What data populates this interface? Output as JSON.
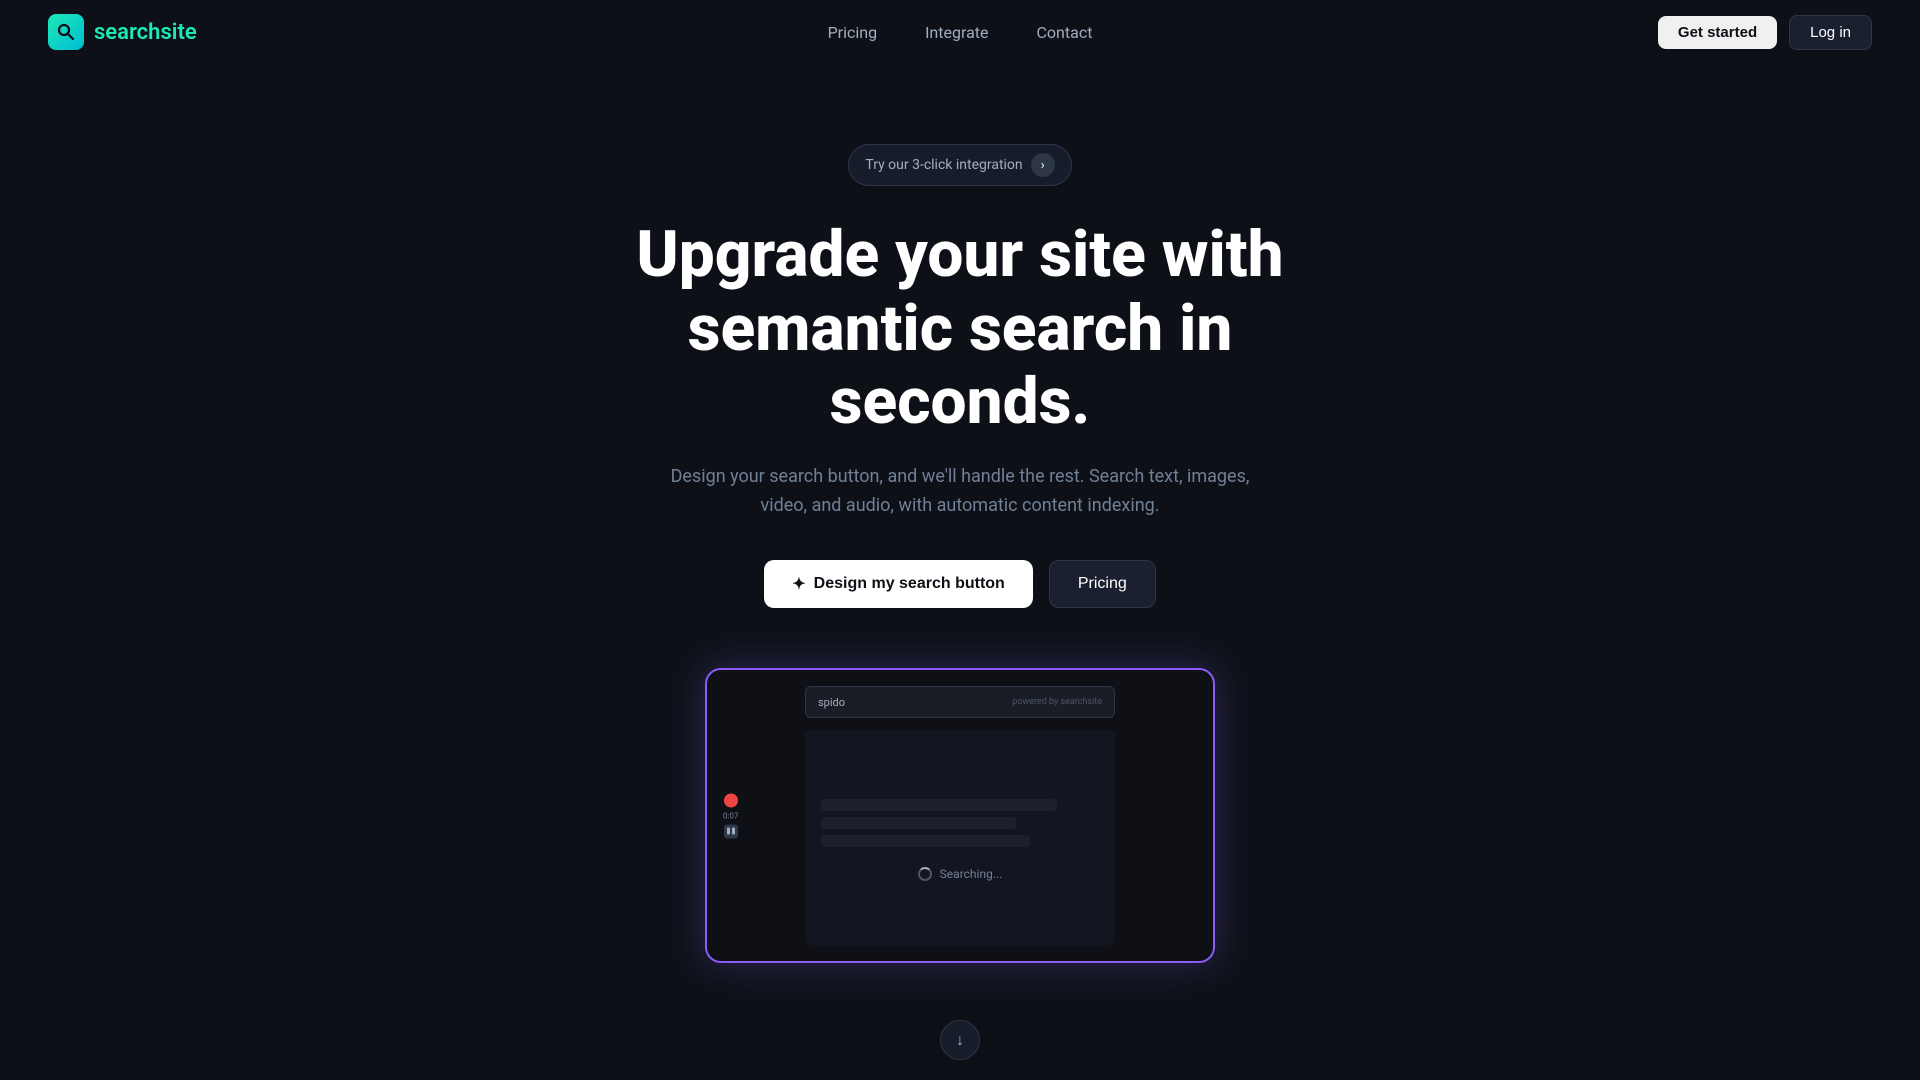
{
  "navbar": {
    "logo_icon": "Q",
    "logo_search": "search",
    "logo_site": "site",
    "nav_links": [
      {
        "id": "pricing",
        "label": "Pricing"
      },
      {
        "id": "integrate",
        "label": "Integrate"
      },
      {
        "id": "contact",
        "label": "Contact"
      }
    ],
    "get_started_label": "Get started",
    "login_label": "Log in"
  },
  "hero": {
    "badge_text": "Try our 3-click integration",
    "title_line1": "Upgrade your site with",
    "title_line2": "semantic search in seconds.",
    "subtitle": "Design your search button, and we'll handle the rest. Search text, images, video, and audio, with automatic content indexing.",
    "btn_design_label": "Design my search button",
    "btn_pricing_label": "Pricing"
  },
  "demo": {
    "search_placeholder": "spido",
    "powered_text": "powered by searchsite",
    "searching_text": "Searching...",
    "rec_time": "0:07"
  },
  "scroll": {
    "icon": "↓"
  }
}
